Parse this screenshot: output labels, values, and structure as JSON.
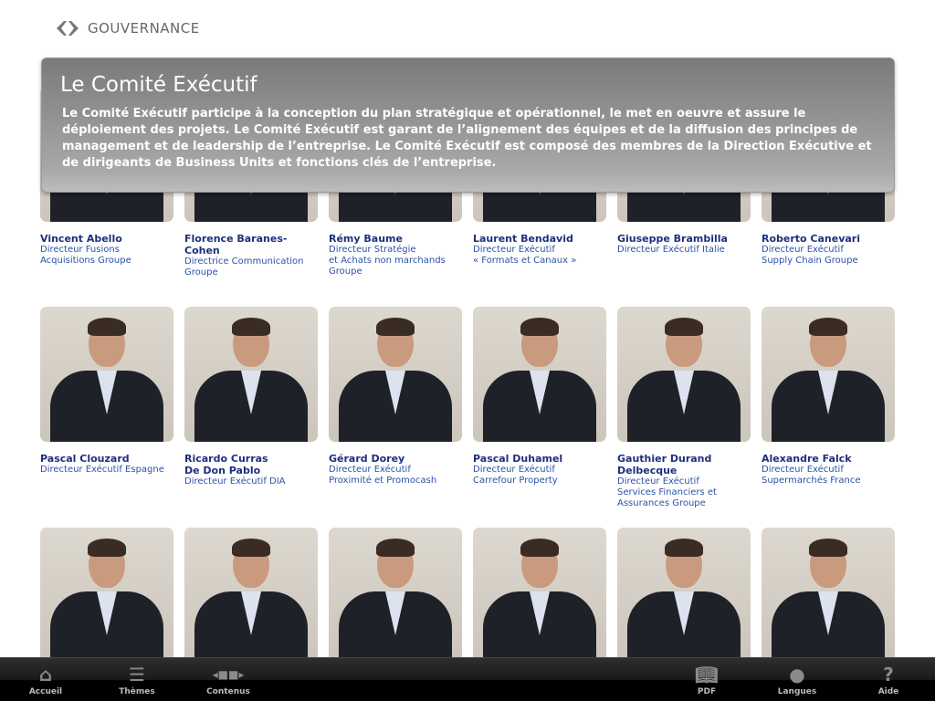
{
  "header": {
    "section": "GOUVERNANCE"
  },
  "panel": {
    "title": "Le Comité Exécutif",
    "text": "Le Comité Exécutif participe à la conception du plan stratégique et opérationnel, le met en oeuvre et assure le déploiement des projets. Le Comité Exécutif est garant de l’alignement des équipes et de la diffusion des principes de management et de leadership de l’entreprise. Le Comité Exécutif est composé des membres de la Direction Exécutive et de dirigeants de Business Units et fonctions clés de l’entreprise."
  },
  "members": [
    {
      "name": "Vincent Abello",
      "role": "Directeur Fusions\nAcquisitions Groupe"
    },
    {
      "name": "Florence Baranes-Cohen",
      "role": "Directrice Communication\nGroupe"
    },
    {
      "name": "Rémy Baume",
      "role": "Directeur Stratégie\net Achats non marchands\nGroupe"
    },
    {
      "name": "Laurent Bendavid",
      "role": "Directeur Exécutif\n« Formats et Canaux »"
    },
    {
      "name": "Giuseppe Brambilla",
      "role": "Directeur Exécutif Italie"
    },
    {
      "name": "Roberto Canevari",
      "role": "Directeur Exécutif\nSupply Chain Groupe"
    },
    {
      "name": "Pascal Clouzard",
      "role": "Directeur Exécutif Espagne"
    },
    {
      "name": "Ricardo Curras\nDe Don Pablo",
      "role": "Directeur Exécutif DIA"
    },
    {
      "name": "Gérard Dorey",
      "role": "Directeur Exécutif\nProximité et Promocash"
    },
    {
      "name": "Pascal Duhamel",
      "role": "Directeur Exécutif\nCarrefour Property"
    },
    {
      "name": "Gauthier Durand\nDelbecque",
      "role": "Directeur Exécutif\nServices Financiers et\nAssurances Groupe"
    },
    {
      "name": "Alexandre Falck",
      "role": "Directeur Exécutif\nSupermarchés France"
    },
    {
      "name": "",
      "role": ""
    },
    {
      "name": "",
      "role": ""
    },
    {
      "name": "",
      "role": ""
    },
    {
      "name": "",
      "role": ""
    },
    {
      "name": "",
      "role": ""
    },
    {
      "name": "",
      "role": ""
    }
  ],
  "toolbar": {
    "home": "Accueil",
    "themes": "Thèmes",
    "contents": "Contenus",
    "pdf": "PDF",
    "languages": "Langues",
    "help": "Aide"
  }
}
